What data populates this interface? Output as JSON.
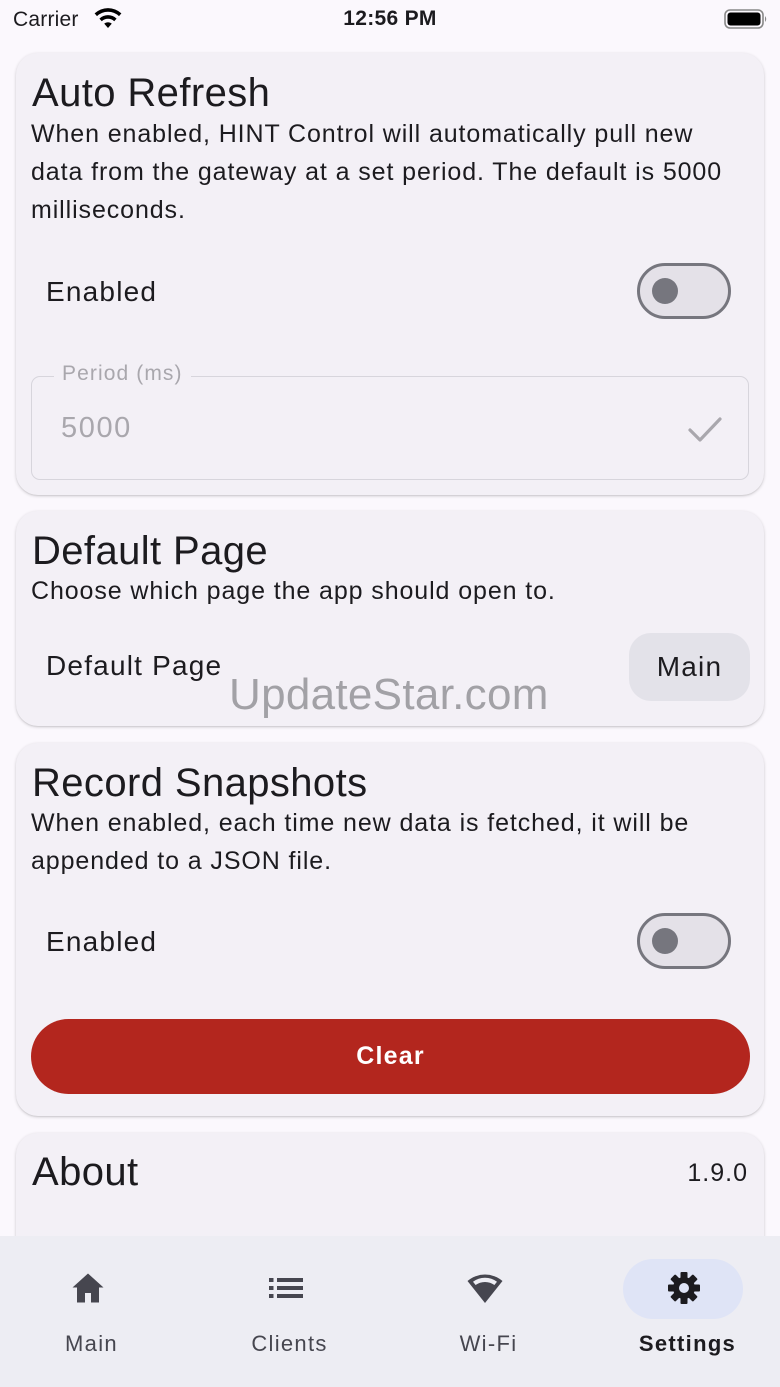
{
  "status_bar": {
    "carrier": "Carrier",
    "time": "12:56 PM"
  },
  "auto_refresh": {
    "title": "Auto Refresh",
    "description": "When enabled, HINT Control will automatically pull new data from the gateway at a set period. The default is 5000 milliseconds.",
    "enabled_label": "Enabled",
    "enabled": false,
    "period_label": "Period (ms)",
    "period_value": "5000"
  },
  "default_page": {
    "title": "Default Page",
    "description": "Choose which page the app should open to.",
    "row_label": "Default Page",
    "selected": "Main"
  },
  "record_snapshots": {
    "title": "Record Snapshots",
    "description": "When enabled, each time new data is fetched, it will be appended to a JSON file.",
    "enabled_label": "Enabled",
    "enabled": false,
    "clear_label": "Clear"
  },
  "about": {
    "title": "About",
    "version": "1.9.0"
  },
  "watermark": "UpdateStar.com",
  "bottom_nav": {
    "items": [
      {
        "label": "Main",
        "icon": "home-icon",
        "active": false
      },
      {
        "label": "Clients",
        "icon": "list-icon",
        "active": false
      },
      {
        "label": "Wi-Fi",
        "icon": "wifi-icon",
        "active": false
      },
      {
        "label": "Settings",
        "icon": "gear-icon",
        "active": true
      }
    ]
  },
  "colors": {
    "background": "#fbf8fd",
    "card": "#f3f0f6",
    "danger": "#b3261e",
    "active_pill": "#dfe4f6",
    "nav_background": "#ededf3"
  }
}
